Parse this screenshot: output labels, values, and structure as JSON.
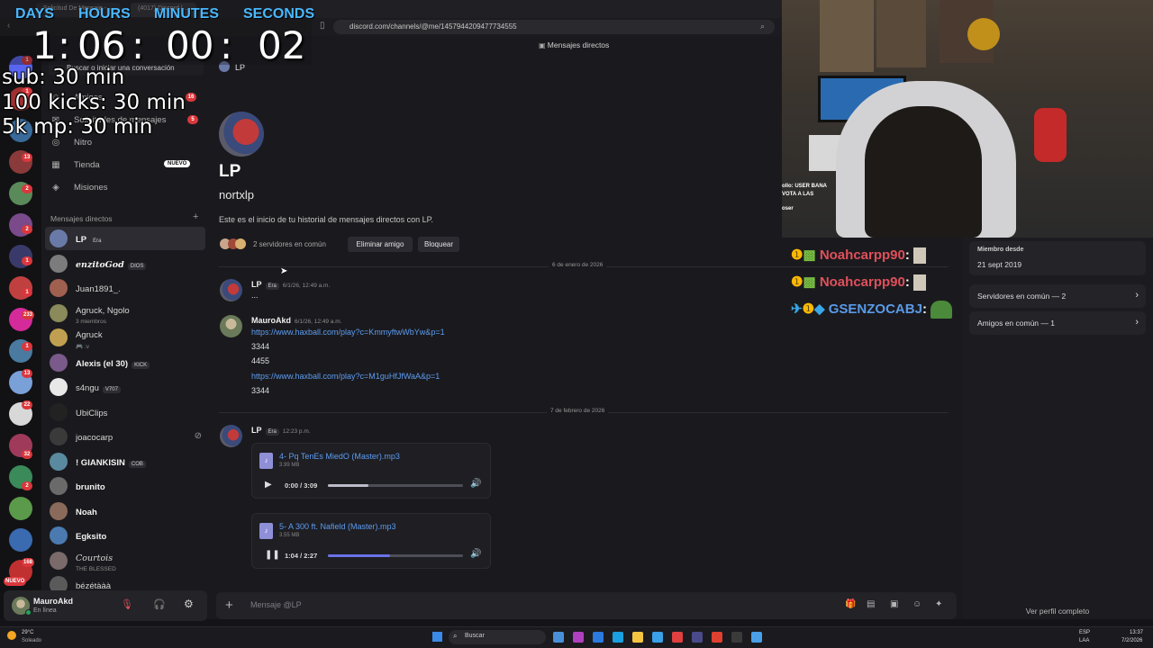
{
  "browser": {
    "tabs": [
      "Solicitud De Mensaje - ...",
      "(4017) Discord | ..."
    ],
    "url": "discord.com/channels/@me/1457944209477734555"
  },
  "timer": {
    "labels": [
      "DAYS",
      "HOURS",
      "MINUTES",
      "SECONDS"
    ],
    "values": [
      "1",
      "06",
      "00",
      "02"
    ],
    "colon": ":"
  },
  "goals": [
    "sub: 30 min",
    "100 kicks: 30 min",
    "5k mp: 30 min"
  ],
  "sidebar": {
    "search_placeholder": "Buscar o iniciar una conversación",
    "menu": [
      {
        "label": "Amigos",
        "badge": "16"
      },
      {
        "label": "Solicitudes de mensajes",
        "badge": "5"
      },
      {
        "label": "Nitro",
        "badge": ""
      },
      {
        "label": "Tienda",
        "badge": "NUEVO"
      },
      {
        "label": "Misiones",
        "badge": ""
      }
    ],
    "dm_header": "Mensajes directos",
    "dm_add": "+",
    "dms": [
      {
        "name": "LP",
        "tag": "Era",
        "sub": "",
        "color": "#6a7aa8"
      },
      {
        "name": "enzitoGod",
        "tag": "DIOS",
        "sub": "",
        "color": "#7c7c7c"
      },
      {
        "name": "Juan1891_.",
        "tag": "",
        "sub": "",
        "color": "#a06050"
      },
      {
        "name": "Agruck, Ngolo",
        "tag": "",
        "sub": "3 miembros",
        "color": "#8a8a5a"
      },
      {
        "name": "Agruck",
        "tag": "",
        "sub": "🎮 :v",
        "color": "#c0a050"
      },
      {
        "name": "Alexis (el 30)",
        "tag": "KICK",
        "sub": "",
        "color": "#7a5a8a"
      },
      {
        "name": "s4ngu",
        "tag": "V707",
        "sub": "",
        "color": "#e8e8e8"
      },
      {
        "name": "UbiClips",
        "tag": "",
        "sub": "",
        "color": "#222222"
      },
      {
        "name": "joacocarp",
        "tag": "",
        "sub": "",
        "color": "#3a3a3a"
      },
      {
        "name": "! GIANKISIN",
        "tag": "COB",
        "sub": "",
        "color": "#5a8aa0"
      },
      {
        "name": "brunito",
        "tag": "",
        "sub": "",
        "color": "#6a6a6a"
      },
      {
        "name": "Noah",
        "tag": "",
        "sub": "",
        "color": "#8a6a5a"
      },
      {
        "name": "Egksito",
        "tag": "",
        "sub": "",
        "color": "#4a7ab0"
      },
      {
        "name": "Courtois",
        "tag": "",
        "sub": "THE BLESSED",
        "color": "#7a6a6a"
      },
      {
        "name": "bézétààà",
        "tag": "",
        "sub": "",
        "color": "#5a5a5a"
      }
    ]
  },
  "server_badges": [
    "1",
    "1",
    "13",
    "2",
    "2",
    "1",
    "1",
    "233",
    "1",
    "13",
    "22",
    "32",
    "2",
    "168",
    "NUEVO"
  ],
  "user": {
    "name": "MauroAkd",
    "status": "En línea"
  },
  "chat": {
    "header_title": "Mensajes directos",
    "recipient": "LP",
    "intro_name": "LP",
    "intro_username": "nortxlp",
    "intro_text": "Este es el inicio de tu historial de mensajes directos con LP.",
    "mutual_servers": "2 servidores en común",
    "remove_friend": "Eliminar amigo",
    "block": "Bloquear",
    "date1": "6 de enero de 2026",
    "date2": "7 de febrero de 2026",
    "messages": [
      {
        "author": "LP",
        "tag": "Era",
        "time": "6/1/26, 12:49 a.m.",
        "lines": [
          "..."
        ]
      },
      {
        "author": "MauroAkd",
        "tag": "",
        "time": "6/1/26, 12:49 a.m.",
        "lines": [
          "https://www.haxball.com/play?c=KmmyftwWbYw&p=1",
          "3344",
          "4455",
          "https://www.haxball.com/play?c=M1guHfJfWaA&p=1",
          "3344"
        ]
      },
      {
        "author": "LP",
        "tag": "Era",
        "time": "12:23 p.m.",
        "lines": []
      }
    ],
    "attachments": [
      {
        "name": "4- Pq TenEs MiedO (Master).mp3",
        "size": "3.99 MB",
        "time": "0:00 / 3:09",
        "progress": 0.3,
        "playing": false
      },
      {
        "name": "5- A 300 ft. Nafield (Master).mp3",
        "size": "3.55 MB",
        "time": "1:04 / 2:27",
        "progress": 0.46,
        "playing": true
      }
    ],
    "composer_placeholder": "Mensaje @LP"
  },
  "profile": {
    "member_since_label": "Miembro desde",
    "member_since": "21 sept 2019",
    "mutual_servers": "Servidores en común — 2",
    "mutual_friends": "Amigos en común — 1",
    "full_profile": "Ver perfil completo"
  },
  "stream_chat": [
    {
      "user": "Noahcarpp90",
      "color": "#e0505a"
    },
    {
      "user": "Noahcarpp90",
      "color": "#e0505a"
    },
    {
      "user": "GSENZOCABJ",
      "color": "#5a9ae8"
    }
  ],
  "cam_chat": [
    "ollo: USER BANA",
    "VOTA A LAS",
    "oser"
  ],
  "taskbar": {
    "weather_temp": "29°C",
    "weather_desc": "Soleado",
    "search": "Buscar",
    "lang": "ESP",
    "lang2": "LAA",
    "time": "13:37",
    "date": "7/2/2026"
  },
  "colors": {
    "accent": "#5865f2",
    "link": "#5d9cf0",
    "badge": "#da373c",
    "timer_label": "#4ab8ff"
  }
}
